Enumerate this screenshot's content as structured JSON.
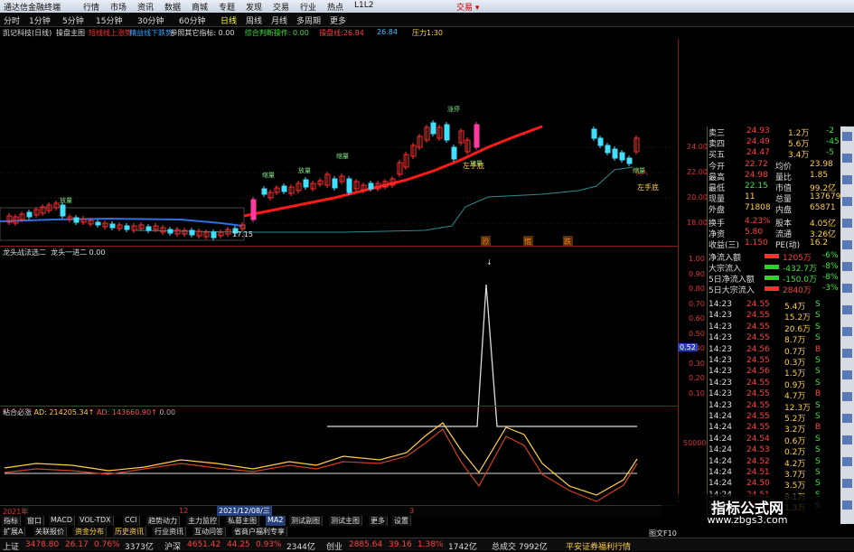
{
  "window": {
    "title": "通达信金融终端",
    "menus": [
      "行情",
      "市场",
      "资讯",
      "数据",
      "商城",
      "专题",
      "发现",
      "交易",
      "行业",
      "热点",
      "L1L2"
    ],
    "trade_button": "交易 ▾"
  },
  "periods": [
    "分时",
    "1分钟",
    "5分钟",
    "15分钟",
    "30分钟",
    "60分钟",
    "日线",
    "周线",
    "月线",
    "多周期",
    "更多"
  ],
  "periods_selected": "日线",
  "info": {
    "stock": "凯记科技(日线)",
    "indicator": "操盘主图",
    "tags": [
      {
        "t": "短线线上涨势",
        "c": "#ff3030"
      },
      {
        "t": "精益线下跌势",
        "c": "#3aa0ff"
      },
      {
        "t": "参照其它指标: 0.00",
        "c": "#dddddd"
      },
      {
        "t": "综合判断操作: 0.00",
        "c": "#40e040"
      },
      {
        "t": "操盘线:26.84",
        "c": "#ff4040"
      },
      {
        "t": "26.84",
        "c": "#40c0ff"
      },
      {
        "t": "压力1:30",
        "c": "#ffd040"
      }
    ]
  },
  "chart_labels": {
    "price_low": "17.15",
    "ann": [
      "缩量",
      "放量",
      "缩量",
      "放量",
      "涨停",
      "放量",
      "缩量"
    ],
    "entry1": "左手底",
    "entry2": "左手底",
    "b": "买入",
    "signals": [
      "恐",
      "慌",
      "跌"
    ]
  },
  "main_yaxis": [
    "24.00",
    "22.00",
    "20.00",
    "18.00"
  ],
  "quote_top": [
    {
      "k": "卖三",
      "v": "24.93",
      "n": "1.2万",
      "c": "-2"
    },
    {
      "k": "卖四",
      "v": "24.49",
      "n": "5.6万",
      "c": "-45"
    },
    {
      "k": "买五",
      "v": "24.47",
      "n": "3.4万",
      "c": "-5"
    }
  ],
  "quote_stats": [
    {
      "k1": "今开",
      "v1": "22.72",
      "k2": "均价",
      "v2": "23.98"
    },
    {
      "k1": "最高",
      "v1": "24.98",
      "k2": "量比",
      "v2": "1.85"
    },
    {
      "k1": "最低",
      "v1": "22.15",
      "k2": "市值",
      "v2": "99.2亿"
    },
    {
      "k1": "现量",
      "v1": "11",
      "k2": "总量",
      "v2": "137679"
    },
    {
      "k1": "外盘",
      "v1": "71808",
      "k2": "内盘",
      "v2": "65871"
    },
    {
      "k1": "换手",
      "v1": "4.23%",
      "k2": "股本",
      "v2": "4.05亿"
    },
    {
      "k1": "净资",
      "v1": "5.80",
      "k2": "流通",
      "v2": "3.26亿"
    },
    {
      "k1": "收益(三)",
      "v1": "1.150",
      "k2": "PE(动)",
      "v2": "16.2"
    }
  ],
  "flows": [
    {
      "k": "净流入额",
      "v": "1205万",
      "p": "-6%"
    },
    {
      "k": "大宗流入",
      "v": "-432.7万",
      "p": "-8%"
    },
    {
      "k": "5日净流入额",
      "v": "-150.0万",
      "p": "-8%"
    },
    {
      "k": "5日大宗流入",
      "v": "2840万",
      "p": "-3%"
    }
  ],
  "ticks": [
    [
      "14:23",
      "24.55",
      "5.4万",
      "S"
    ],
    [
      "14:23",
      "24.55",
      "15.2万",
      "S"
    ],
    [
      "14:23",
      "24.55",
      "20.6万",
      "S"
    ],
    [
      "14:23",
      "24.55",
      "8.7万",
      "S"
    ],
    [
      "14:23",
      "24.56",
      "0.7万",
      "B"
    ],
    [
      "14:23",
      "24.55",
      "0.3万",
      "S"
    ],
    [
      "14:23",
      "24.56",
      "1.5万",
      "S"
    ],
    [
      "14:23",
      "24.55",
      "0.9万",
      "S"
    ],
    [
      "14:23",
      "24.55",
      "4.7万",
      "B"
    ],
    [
      "14:23",
      "24.55",
      "12.3万",
      "S"
    ],
    [
      "14:24",
      "24.55",
      "5.2万",
      "S"
    ],
    [
      "14:24",
      "24.55",
      "3.2万",
      "B"
    ],
    [
      "14:24",
      "24.54",
      "0.6万",
      "S"
    ],
    [
      "14:24",
      "24.53",
      "0.2万",
      "S"
    ],
    [
      "14:24",
      "24.52",
      "4.2万",
      "S"
    ],
    [
      "14:24",
      "24.51",
      "3.7万",
      "S"
    ],
    [
      "14:24",
      "24.50",
      "3.5万",
      "S"
    ],
    [
      "14:24",
      "24.51",
      "8.1万",
      "S"
    ],
    [
      "14:24",
      "24.51",
      "1.3万",
      "S"
    ]
  ],
  "panel2": {
    "name": "龙头战法选二",
    "text": "龙头一进二 0.00",
    "axis": [
      "1.00",
      "0.90",
      "0.80",
      "0.70",
      "0.60",
      "0.52",
      "0.50",
      "0.40",
      "0.30",
      "0.20",
      "0.10"
    ],
    "cursor": "0.52"
  },
  "panel3": {
    "name": "粘合必涨",
    "text1": "AD: 214205.34↑",
    "text2": "AD: 143660.90↑",
    "text3": "0.00",
    "axis": "50000"
  },
  "dates": {
    "left": "2021年",
    "mid": "12",
    "cursor": "2021/12/08/三",
    "mid2": "3",
    "right": "图文F10"
  },
  "tabs": [
    "指标",
    "窗口",
    "MACD",
    "VOL-TDX",
    "CCI",
    "趋势动力",
    "主力监控",
    "私募主图",
    "MA2",
    "测试副图",
    "测试主图",
    "更多",
    "设置"
  ],
  "tabs_selected": "MA2",
  "tabs2": [
    "扩展A",
    "关联报价",
    "资金分布",
    "历史资讯",
    "行业资讯",
    "互动问答",
    "省商户福利专享"
  ],
  "status": [
    {
      "k": "上证",
      "v": "3478.80",
      "c": "26.17",
      "p": "0.76%",
      "a": "3373亿"
    },
    {
      "k": "沪深",
      "v": "4651.42",
      "c": "44.25",
      "p": "0.93%",
      "a": "2344亿"
    },
    {
      "k": "创业",
      "v": "2885.64",
      "c": "39.16",
      "p": "1.38%",
      "a": "1742亿"
    }
  ],
  "status_total": "总成交 7992亿",
  "status_right": "平安证券福利行情",
  "watermark": {
    "title": "指标公式网",
    "url": "www.zbgs3.com"
  },
  "rtool_icons": [
    "home-icon",
    "edit-icon",
    "chart-icon",
    "star-icon",
    "list-icon",
    "rsi-icon",
    "grid-icon",
    "money-icon",
    "arrow-icon",
    "lock-icon",
    "bar-icon",
    "user-icon",
    "tools-icon",
    "info-icon",
    "doc-icon",
    "bell-icon",
    "gear-icon",
    "more-icon"
  ]
}
